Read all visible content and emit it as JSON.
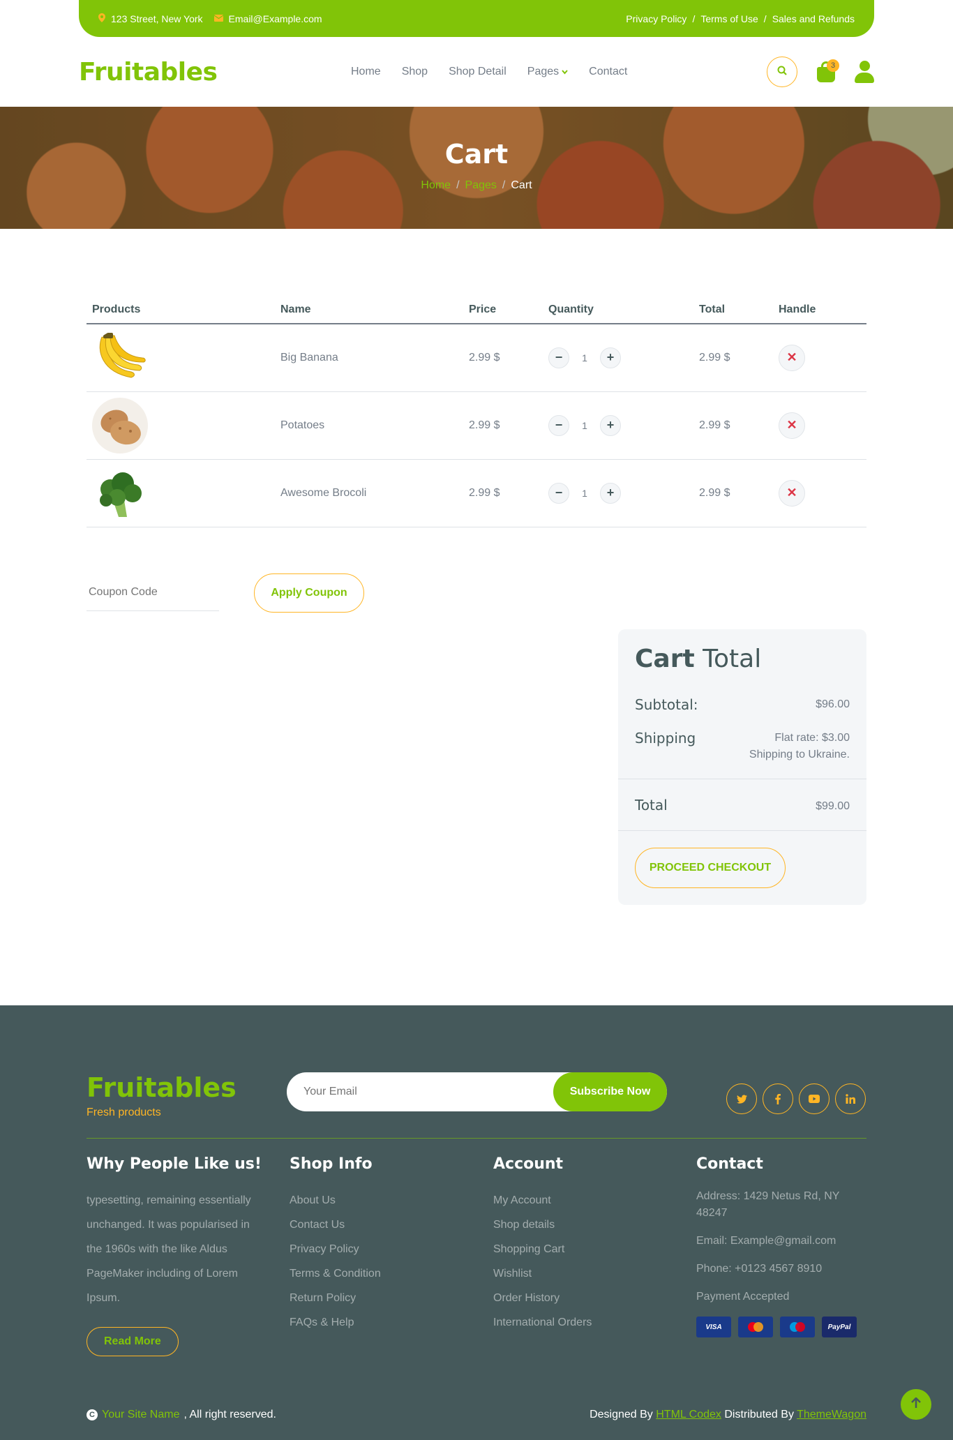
{
  "topbar": {
    "address": "123 Street, New York",
    "email": "Email@Example.com",
    "links": [
      "Privacy Policy",
      "Terms of Use",
      "Sales and Refunds"
    ],
    "separator": "/"
  },
  "navbar": {
    "brand": "Fruitables",
    "menu": [
      "Home",
      "Shop",
      "Shop Detail",
      "Pages",
      "Contact"
    ],
    "active_item": "Pages",
    "cart_count": "3"
  },
  "hero": {
    "title": "Cart",
    "breadcrumb": [
      "Home",
      "Pages",
      "Cart"
    ],
    "separator": "/"
  },
  "cart": {
    "columns": [
      "Products",
      "Name",
      "Price",
      "Quantity",
      "Total",
      "Handle"
    ],
    "rows": [
      {
        "name": "Big Banana",
        "price": "2.99 $",
        "qty": "1",
        "total": "2.99 $"
      },
      {
        "name": "Potatoes",
        "price": "2.99 $",
        "qty": "1",
        "total": "2.99 $"
      },
      {
        "name": "Awesome Brocoli",
        "price": "2.99 $",
        "qty": "1",
        "total": "2.99 $"
      }
    ],
    "coupon_placeholder": "Coupon Code",
    "apply_label": "Apply Coupon"
  },
  "cart_total": {
    "title_bold": "Cart",
    "title_rest": "Total",
    "subtotal_label": "Subtotal:",
    "subtotal_value": "$96.00",
    "shipping_label": "Shipping",
    "shipping_rate": "Flat rate: $3.00",
    "shipping_dest": "Shipping to Ukraine.",
    "total_label": "Total",
    "total_value": "$99.00",
    "checkout_label": "PROCEED CHECKOUT"
  },
  "footer": {
    "brand": "Fruitables",
    "tagline": "Fresh products",
    "email_placeholder": "Your Email",
    "subscribe_label": "Subscribe Now",
    "col1": {
      "title": "Why People Like us!",
      "text": "typesetting, remaining essentially unchanged. It was popularised in the 1960s with the like Aldus PageMaker including of Lorem Ipsum.",
      "button": "Read More"
    },
    "col2": {
      "title": "Shop Info",
      "links": [
        "About Us",
        "Contact Us",
        "Privacy Policy",
        "Terms & Condition",
        "Return Policy",
        "FAQs & Help"
      ]
    },
    "col3": {
      "title": "Account",
      "links": [
        "My Account",
        "Shop details",
        "Shopping Cart",
        "Wishlist",
        "Order History",
        "International Orders"
      ]
    },
    "col4": {
      "title": "Contact",
      "address": "Address: 1429 Netus Rd, NY 48247",
      "email": "Email: Example@gmail.com",
      "phone": "Phone: +0123 4567 8910",
      "payment": "Payment Accepted",
      "cards": [
        "VISA",
        "MasterCard",
        "Maestro",
        "PayPal"
      ]
    },
    "copyright_site": "Your Site Name",
    "copyright_rest": ", All right reserved.",
    "designed_by": "Designed By",
    "designer": "HTML Codex",
    "distributed_by": "Distributed By",
    "distributor": "ThemeWagon"
  },
  "colors": {
    "primary": "#81c408",
    "secondary": "#ffb524",
    "dark": "#45595b",
    "body_text": "#747d88",
    "danger": "#dc3545"
  },
  "icons": [
    "map-marker-icon",
    "envelope-icon",
    "search-icon",
    "shopping-bag-icon",
    "user-icon",
    "minus-icon",
    "plus-icon",
    "times-icon",
    "twitter-icon",
    "facebook-icon",
    "youtube-icon",
    "linkedin-icon",
    "copyright-icon",
    "arrow-up-icon"
  ]
}
